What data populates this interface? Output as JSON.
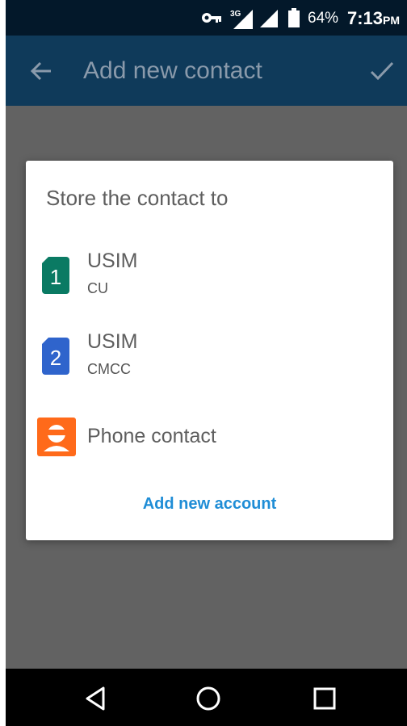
{
  "status_bar": {
    "network_type": "3G",
    "battery_percent": "64%",
    "time": "7:13",
    "ampm": "PM"
  },
  "app_bar": {
    "title": "Add new contact"
  },
  "dialog": {
    "title": "Store the contact to",
    "options": [
      {
        "name": "USIM",
        "subtitle": "CU",
        "icon_label": "1",
        "icon": "sim-1-icon",
        "color": "#0a7a63"
      },
      {
        "name": "USIM",
        "subtitle": "CMCC",
        "icon_label": "2",
        "icon": "sim-2-icon",
        "color": "#2f64cc"
      },
      {
        "name": "Phone contact",
        "icon": "phone-contact-icon",
        "color": "#ff6a1a"
      }
    ],
    "add_account_label": "Add new account"
  },
  "colors": {
    "status_bar": "#03182a",
    "app_bar_dimmed": "#0f3a5a",
    "scrim": "#626262",
    "accent_link": "#1f8dd6"
  }
}
